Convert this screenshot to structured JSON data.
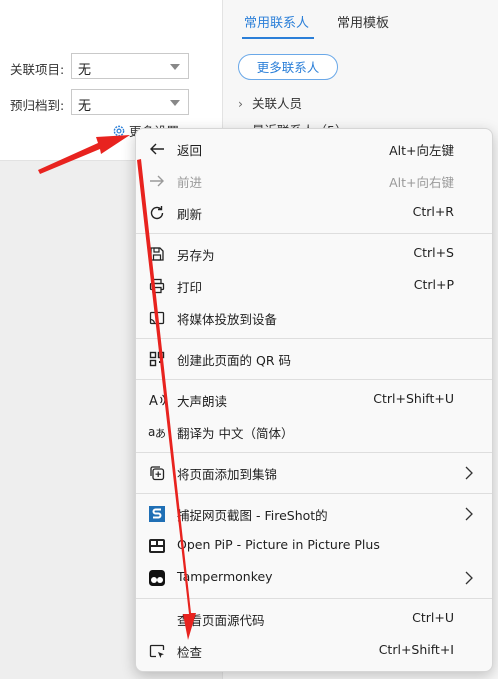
{
  "tabs": [
    {
      "label": "常用联系人",
      "active": true
    },
    {
      "label": "常用模板",
      "active": false
    }
  ],
  "form": {
    "rows": [
      {
        "label": "关联项目:",
        "value": "无"
      },
      {
        "label": "预归档到:",
        "value": "无"
      }
    ],
    "more_settings": "更多设置"
  },
  "contacts": {
    "more_button": "更多联系人",
    "tree": [
      {
        "label": "关联人员"
      },
      {
        "label": "最近联系人（5）"
      }
    ]
  },
  "context_menu": {
    "items": [
      {
        "label": "返回",
        "shortcut": "Alt+向左键",
        "icon": "back-arrow-icon",
        "disabled": false
      },
      {
        "label": "前进",
        "shortcut": "Alt+向右键",
        "icon": "forward-arrow-icon",
        "disabled": true
      },
      {
        "label": "刷新",
        "shortcut": "Ctrl+R",
        "icon": "refresh-icon",
        "disabled": false
      },
      {
        "label": "另存为",
        "shortcut": "Ctrl+S",
        "icon": "save-as-icon",
        "disabled": false
      },
      {
        "label": "打印",
        "shortcut": "Ctrl+P",
        "icon": "print-icon",
        "disabled": false
      },
      {
        "label": "将媒体投放到设备",
        "shortcut": "",
        "icon": "cast-icon",
        "disabled": false
      },
      {
        "label": "创建此页面的 QR 码",
        "shortcut": "",
        "icon": "qr-code-icon",
        "disabled": false
      },
      {
        "label": "大声朗读",
        "shortcut": "Ctrl+Shift+U",
        "icon": "read-aloud-icon",
        "disabled": false
      },
      {
        "label": "翻译为 中文（简体）",
        "shortcut": "",
        "icon": "translate-icon",
        "disabled": false
      },
      {
        "label": "将页面添加到集锦",
        "shortcut": "",
        "icon": "collections-icon",
        "disabled": false,
        "submenu": true
      },
      {
        "label": "捕捉网页截图 - FireShot的",
        "shortcut": "",
        "icon": "fireshot-icon",
        "disabled": false,
        "submenu": true
      },
      {
        "label": "Open PiP - Picture in Picture Plus",
        "shortcut": "",
        "icon": "pip-icon",
        "disabled": false
      },
      {
        "label": "Tampermonkey",
        "shortcut": "",
        "icon": "tampermonkey-icon",
        "disabled": false,
        "submenu": true
      },
      {
        "label": "查看页面源代码",
        "shortcut": "Ctrl+U",
        "icon": "",
        "disabled": false
      },
      {
        "label": "检查",
        "shortcut": "Ctrl+Shift+I",
        "icon": "inspect-icon",
        "disabled": false
      }
    ]
  },
  "colors": {
    "accent": "#2b7fd8",
    "annotation_arrow": "#e8231f"
  }
}
